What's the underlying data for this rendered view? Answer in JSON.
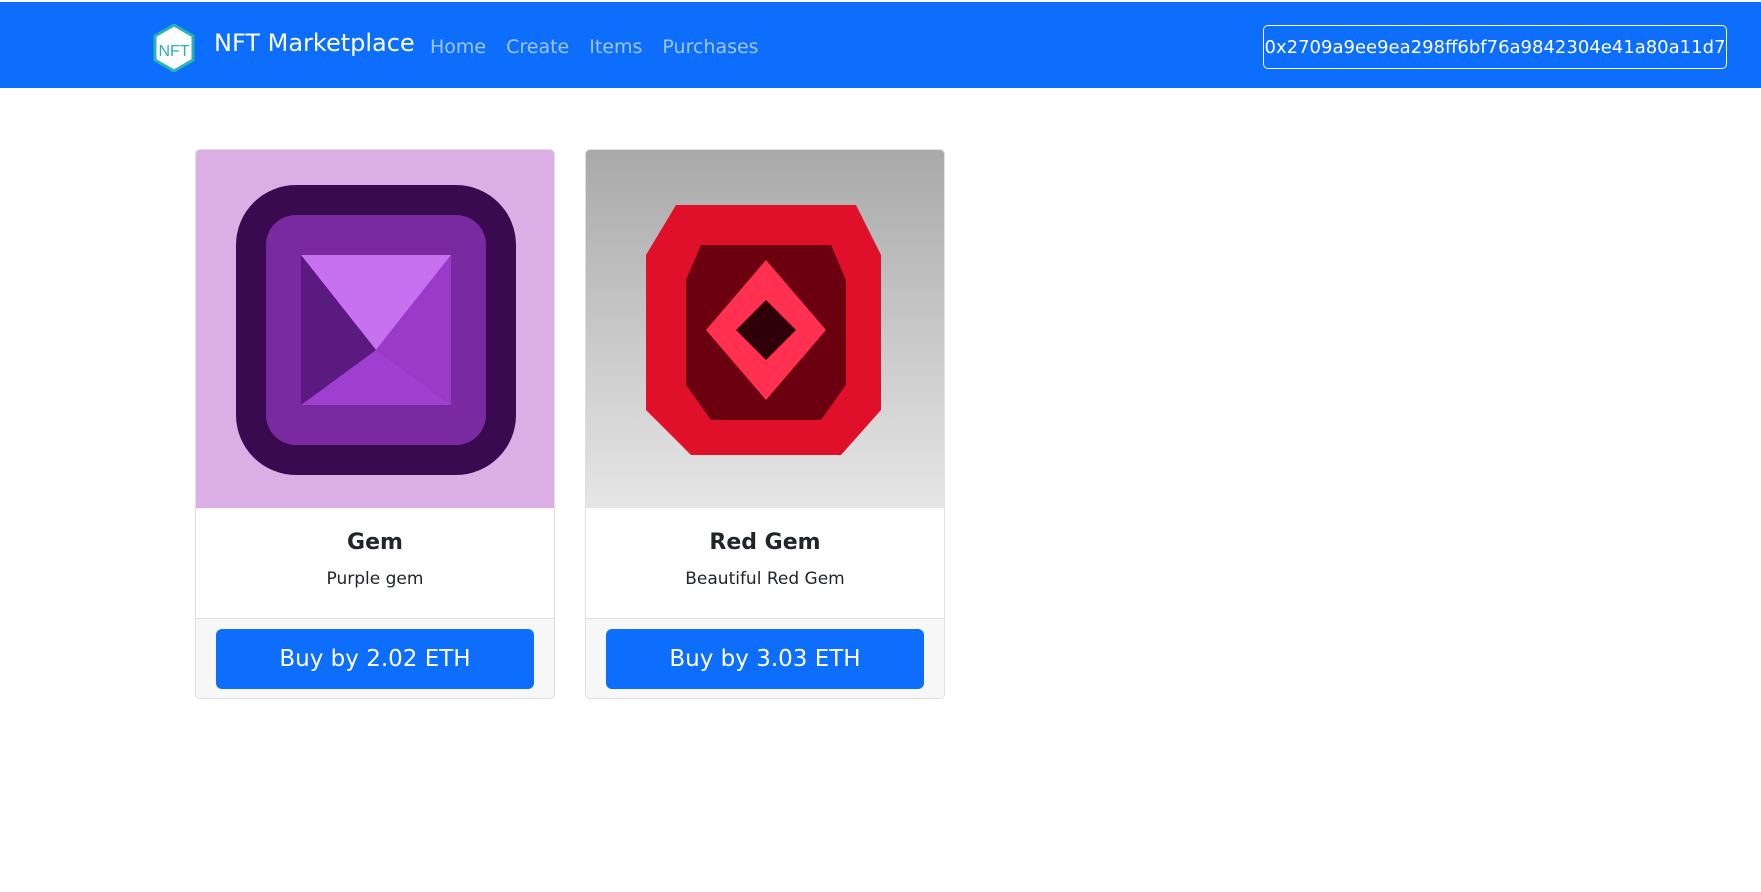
{
  "navbar": {
    "brand": "NFT Marketplace",
    "logo_text": "NFT",
    "links": [
      "Home",
      "Create",
      "Items",
      "Purchases"
    ],
    "wallet_address": "0x2709a9ee9ea298ff6bf76a9842304e41a80a11d7",
    "color": "#0d6efd"
  },
  "items": [
    {
      "name": "Gem",
      "description": "Purple gem",
      "buy_label": "Buy by 2.02 ETH",
      "image_colors": [
        "#dcaee6",
        "#7a2aa0",
        "#c770f0"
      ]
    },
    {
      "name": "Red Gem",
      "description": "Beautiful Red Gem",
      "buy_label": "Buy by 3.03 ETH",
      "image_colors": [
        "#cfcfcf",
        "#e0102a",
        "#6a0010"
      ]
    }
  ]
}
